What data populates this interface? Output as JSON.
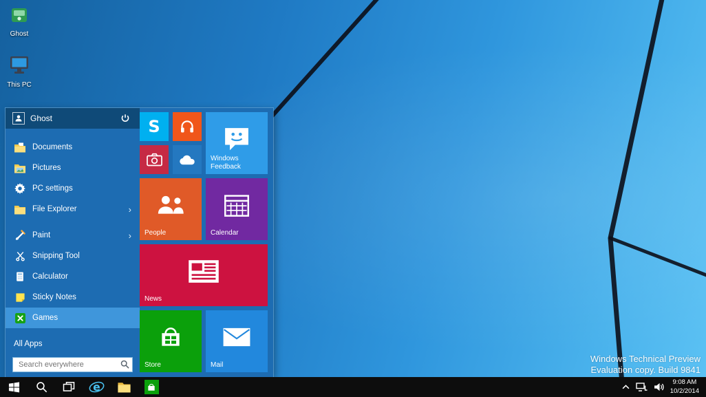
{
  "desktop": {
    "icons": [
      {
        "label": "Ghost"
      },
      {
        "label": "This PC"
      }
    ],
    "watermark": {
      "line1": "Windows Technical Preview",
      "line2": "Evaluation copy. Build 9841"
    }
  },
  "start_menu": {
    "header": {
      "user_name": "Ghost"
    },
    "left_items": [
      {
        "label": "Documents"
      },
      {
        "label": "Pictures"
      },
      {
        "label": "PC settings"
      },
      {
        "label": "File Explorer",
        "has_submenu": true
      },
      {
        "label": "Paint",
        "has_submenu": true
      },
      {
        "label": "Snipping Tool"
      },
      {
        "label": "Calculator"
      },
      {
        "label": "Sticky Notes"
      },
      {
        "label": "Games",
        "highlighted": true
      },
      {
        "label": "All Apps"
      }
    ],
    "search": {
      "placeholder": "Search everywhere"
    },
    "tiles": [
      {
        "name": "Skype",
        "size": "small",
        "color": "#00b0f0"
      },
      {
        "name": "Music",
        "size": "small",
        "color": "#f0561a"
      },
      {
        "name": "Camera",
        "size": "small",
        "color": "#c62a44"
      },
      {
        "name": "OneDrive",
        "size": "small",
        "color": "#2478c0"
      },
      {
        "name": "Windows Feedback",
        "label": "Windows Feedback",
        "size": "medium",
        "color": "#2f9ce8"
      },
      {
        "name": "People",
        "label": "People",
        "size": "medium",
        "color": "#e05a28"
      },
      {
        "name": "Calendar",
        "label": "Calendar",
        "size": "medium",
        "color": "#7129a1"
      },
      {
        "name": "News",
        "label": "News",
        "size": "wide",
        "color": "#cd1240"
      },
      {
        "name": "Store",
        "label": "Store",
        "size": "medium",
        "color": "#0ba00b"
      },
      {
        "name": "Mail",
        "label": "Mail",
        "size": "medium",
        "color": "#2288dd"
      }
    ]
  },
  "taskbar": {
    "tray": {
      "time": "9:08 AM",
      "date": "10/2/2014"
    }
  },
  "colors": {
    "menu_bg": "#1d6cb2",
    "menu_header_bg": "#0f4a78",
    "menu_highlight": "#3f96db",
    "taskbar_bg": "#0d0d0d"
  }
}
